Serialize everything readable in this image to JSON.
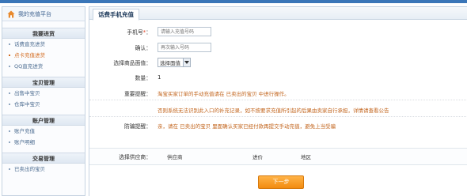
{
  "sidebar": {
    "home_label": "我的充值平台",
    "sections": [
      {
        "title": "我要进货",
        "items": [
          "话费直充进货",
          "点卡充值进货",
          "QQ直充进货"
        ],
        "active_index": 1
      },
      {
        "title": "宝贝管理",
        "items": [
          "出售中宝贝",
          "仓库中宝贝"
        ]
      },
      {
        "title": "账户管理",
        "items": [
          "账户充值",
          "账户明细"
        ]
      },
      {
        "title": "交易管理",
        "items": [
          "已卖出的宝贝"
        ]
      }
    ]
  },
  "main": {
    "tab_label": "话费手机充值",
    "form": {
      "phone_label": "手机号",
      "phone_required_mark": "*",
      "phone_label_colon": "：",
      "phone_placeholder": "请输入充值号码",
      "confirm_label": "确认：",
      "confirm_placeholder": "再次输入号码",
      "face_value_label": "选择商品面值：",
      "face_value_selected": "选择面值",
      "quantity_label": "数量：",
      "quantity_value": "1",
      "important_label": "重要提醒：",
      "important_note_1": "淘宝买家订单的手动充值请在 已卖出的宝贝 中进行操作。",
      "important_note_2": "否则系统无法识别此入口的补充记录，如不按要求充值所引起的后果由卖家自行承担，详情请查看公告",
      "fraud_label": "防骗提醒：",
      "fraud_note": "亲，请在 已卖出的宝贝 里面确认买家已经付款再提交手动充值，避免上当受骗",
      "supplier_label": "选择供应商：",
      "supplier_columns": [
        "供应商",
        "进价",
        "地区"
      ]
    },
    "next_button": "下一步"
  }
}
